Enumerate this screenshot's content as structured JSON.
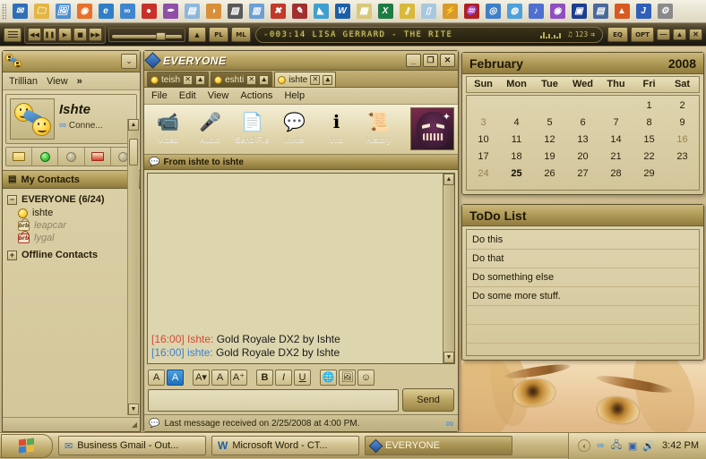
{
  "quicklaunch": {
    "icons": [
      {
        "name": "outlook-icon",
        "glyph": "✉",
        "color": "#2f6fb8"
      },
      {
        "name": "folder-icon",
        "glyph": "🗀",
        "color": "#e3b544"
      },
      {
        "name": "photo-viewer-icon",
        "glyph": "🖼",
        "color": "#4f8fd0"
      },
      {
        "name": "firefox-icon",
        "glyph": "◉",
        "color": "#e8702a"
      },
      {
        "name": "internet-explorer-icon",
        "glyph": "e",
        "color": "#2f7fc8"
      },
      {
        "name": "trillian-icon",
        "glyph": "∞",
        "color": "#3f86cf"
      },
      {
        "name": "red-blob-icon",
        "glyph": "●",
        "color": "#c8312a"
      },
      {
        "name": "pen-icon",
        "glyph": "✒",
        "color": "#8e4fa8"
      },
      {
        "name": "notepad-icon",
        "glyph": "▤",
        "color": "#8fb7dd"
      },
      {
        "name": "paint-palette-icon",
        "glyph": "◑",
        "color": "#d88f3a"
      },
      {
        "name": "cursor-tool-icon",
        "glyph": "▨",
        "color": "#5a5a5a"
      },
      {
        "name": "blue-document-icon",
        "glyph": "▥",
        "color": "#6d9fd4"
      },
      {
        "name": "red-ribbon-icon",
        "glyph": "✖",
        "color": "#c0392b"
      },
      {
        "name": "quill-icon",
        "glyph": "✎",
        "color": "#a03030"
      },
      {
        "name": "sail-icon",
        "glyph": "◣",
        "color": "#3f9fd0"
      },
      {
        "name": "word-icon",
        "glyph": "W",
        "color": "#1b5fa8"
      },
      {
        "name": "excel-chart-icon",
        "glyph": "▦",
        "color": "#d8c87a"
      },
      {
        "name": "excel-icon",
        "glyph": "X",
        "color": "#1e7a43"
      },
      {
        "name": "key-icon",
        "glyph": "⚷",
        "color": "#d8b93a"
      },
      {
        "name": "page-icon",
        "glyph": "▯",
        "color": "#a8c8e0"
      },
      {
        "name": "lightning-icon",
        "glyph": "⚡",
        "color": "#d89a2a"
      },
      {
        "name": "fountain-icon",
        "glyph": "♒",
        "color": "#b02020"
      },
      {
        "name": "cd-player-icon",
        "glyph": "◎",
        "color": "#3f7fc8"
      },
      {
        "name": "media-icon",
        "glyph": "◍",
        "color": "#4fa0d8"
      },
      {
        "name": "music-icon",
        "glyph": "♪",
        "color": "#4f6fd0"
      },
      {
        "name": "purple-disc-icon",
        "glyph": "◉",
        "color": "#8e4fc0"
      },
      {
        "name": "screen-icon",
        "glyph": "▣",
        "color": "#1b3f8f"
      },
      {
        "name": "book-icon",
        "glyph": "▤",
        "color": "#4a6a9a"
      },
      {
        "name": "flame-icon",
        "glyph": "▲",
        "color": "#d85a20"
      },
      {
        "name": "jet-icon",
        "glyph": "J",
        "color": "#2f5fb8"
      },
      {
        "name": "gadget-icon",
        "glyph": "⚙",
        "color": "#8a8a8a"
      }
    ]
  },
  "player": {
    "menu_label": "≡",
    "transport": [
      {
        "name": "previous-button",
        "label": "◀◀"
      },
      {
        "name": "pause-button",
        "label": "❚❚"
      },
      {
        "name": "play-button",
        "label": "▶"
      },
      {
        "name": "stop-button",
        "label": "■"
      },
      {
        "name": "next-button",
        "label": "▶▶"
      }
    ],
    "eject_label": "▲",
    "playlist_label": "PL",
    "medialibrary_label": "ML",
    "track_display": "-003:14  LISA GERRARD  -  THE RITE",
    "bitrate_label": "123",
    "eq_label": "EQ",
    "opt_label": "OPT",
    "window_controls": [
      {
        "name": "player-minimize-button",
        "label": "—"
      },
      {
        "name": "player-shade-button",
        "label": "▲"
      },
      {
        "name": "player-close-button",
        "label": "✕"
      }
    ]
  },
  "trillian": {
    "menu": [
      "Trillian",
      "View",
      "»"
    ],
    "collapse_label": "⌄",
    "profile": {
      "name": "Ishte",
      "status": "Conne..."
    },
    "status_buttons": [
      {
        "name": "status-available-button",
        "kind": "envelope-yellow"
      },
      {
        "name": "status-online-button",
        "kind": "dot-green"
      },
      {
        "name": "status-idle-button",
        "kind": "dot-gray"
      },
      {
        "name": "status-message-button",
        "kind": "envelope-red"
      },
      {
        "name": "status-offline-button",
        "kind": "dot-gray"
      }
    ],
    "contacts_header": "My Contacts",
    "groups": [
      {
        "name": "EVERYONE (6/24)",
        "expander": "−",
        "buddies": [
          {
            "name": "ishte",
            "state": "online",
            "icon": "online-dot"
          },
          {
            "name": "leapcar",
            "state": "away",
            "icon": "brb"
          },
          {
            "name": "lygal",
            "state": "away",
            "icon": "brb-red"
          }
        ]
      },
      {
        "name": "Offline Contacts",
        "expander": "+",
        "buddies": []
      }
    ]
  },
  "chat": {
    "title": "EVERYONE",
    "window_controls": [
      {
        "name": "chat-minimize-button",
        "label": "_"
      },
      {
        "name": "chat-maximize-button",
        "label": "❐"
      },
      {
        "name": "chat-close-button",
        "label": "✕"
      }
    ],
    "tabs": [
      {
        "label": "teish",
        "active": false
      },
      {
        "label": "eshti",
        "active": false
      },
      {
        "label": "ishte",
        "active": true
      }
    ],
    "tab_close_label": "✕",
    "tab_detach_label": "▲",
    "menu": [
      "File",
      "Edit",
      "View",
      "Actions",
      "Help"
    ],
    "toolbar": [
      {
        "name": "video-button",
        "label": "Video",
        "glyph": "📹"
      },
      {
        "name": "audio-button",
        "label": "Audio",
        "glyph": "🎤"
      },
      {
        "name": "send-file-button",
        "label": "Send File",
        "glyph": "📄"
      },
      {
        "name": "invite-button",
        "label": "Invite",
        "glyph": "💬"
      },
      {
        "name": "info-button",
        "label": "Info",
        "glyph": "ℹ"
      },
      {
        "name": "history-button",
        "label": "History",
        "glyph": "📜"
      }
    ],
    "conversation_header": "From ishte to ishte",
    "messages": [
      {
        "time": "[16:00]",
        "sender": "Ishte:",
        "text": "Gold Royale DX2 by Ishte",
        "color": "red"
      },
      {
        "time": "[16:00]",
        "sender": "ishte:",
        "text": "Gold Royale DX2 by Ishte",
        "color": "blue"
      }
    ],
    "format_buttons": [
      {
        "name": "font-color-button",
        "label": "A",
        "selected": false
      },
      {
        "name": "font-background-button",
        "label": "A",
        "selected": true
      },
      {
        "name": "font-family-button",
        "label": "A▾",
        "selected": false
      },
      {
        "name": "font-size-down-button",
        "label": "A",
        "selected": false
      },
      {
        "name": "font-size-up-button",
        "label": "A⁺",
        "selected": false
      },
      {
        "name": "bold-button",
        "label": "B",
        "selected": false
      },
      {
        "name": "italic-button",
        "label": "I",
        "selected": false
      },
      {
        "name": "underline-button",
        "label": "U",
        "selected": false
      },
      {
        "name": "insert-link-button",
        "label": "🌐",
        "selected": false
      },
      {
        "name": "insert-image-button",
        "label": "🖼",
        "selected": false
      },
      {
        "name": "emoticon-button",
        "label": "☺",
        "selected": false
      }
    ],
    "input_value": "",
    "send_label": "Send",
    "status_text": "Last message received on 2/25/2008 at 4:00 PM."
  },
  "calendar": {
    "month": "February",
    "year": "2008",
    "day_headers": [
      "Sun",
      "Mon",
      "Tue",
      "Wed",
      "Thu",
      "Fri",
      "Sat"
    ],
    "cells": [
      {
        "d": "",
        "style": ""
      },
      {
        "d": "",
        "style": ""
      },
      {
        "d": "",
        "style": ""
      },
      {
        "d": "",
        "style": ""
      },
      {
        "d": "",
        "style": ""
      },
      {
        "d": "1",
        "style": ""
      },
      {
        "d": "2",
        "style": ""
      },
      {
        "d": "3",
        "style": "dim"
      },
      {
        "d": "4",
        "style": ""
      },
      {
        "d": "5",
        "style": ""
      },
      {
        "d": "6",
        "style": ""
      },
      {
        "d": "7",
        "style": ""
      },
      {
        "d": "8",
        "style": ""
      },
      {
        "d": "9",
        "style": ""
      },
      {
        "d": "10",
        "style": ""
      },
      {
        "d": "11",
        "style": ""
      },
      {
        "d": "12",
        "style": ""
      },
      {
        "d": "13",
        "style": ""
      },
      {
        "d": "14",
        "style": ""
      },
      {
        "d": "15",
        "style": ""
      },
      {
        "d": "16",
        "style": "dim"
      },
      {
        "d": "17",
        "style": ""
      },
      {
        "d": "18",
        "style": ""
      },
      {
        "d": "19",
        "style": ""
      },
      {
        "d": "20",
        "style": ""
      },
      {
        "d": "21",
        "style": ""
      },
      {
        "d": "22",
        "style": ""
      },
      {
        "d": "23",
        "style": ""
      },
      {
        "d": "24",
        "style": "dim"
      },
      {
        "d": "25",
        "style": "today"
      },
      {
        "d": "26",
        "style": ""
      },
      {
        "d": "27",
        "style": ""
      },
      {
        "d": "28",
        "style": ""
      },
      {
        "d": "29",
        "style": ""
      },
      {
        "d": "",
        "style": ""
      }
    ]
  },
  "todo": {
    "title": "ToDo List",
    "items": [
      "Do this",
      "Do that",
      "Do something else",
      "Do some more stuff.",
      "",
      ""
    ]
  },
  "taskbar": {
    "start_label": "",
    "tasks": [
      {
        "label": "Business Gmail - Out...",
        "icon": "outlook-icon",
        "active": false
      },
      {
        "label": "Microsoft Word - CT...",
        "icon": "word-icon",
        "active": false
      },
      {
        "label": "EVERYONE",
        "icon": "trillian-diamond-icon",
        "active": true
      }
    ],
    "tray_icons": [
      {
        "name": "tray-expand-icon",
        "glyph": "‹"
      },
      {
        "name": "tray-trillian-icon",
        "glyph": "∞"
      },
      {
        "name": "tray-network-icon",
        "glyph": "🖧"
      },
      {
        "name": "tray-app-icon",
        "glyph": "▣"
      },
      {
        "name": "tray-volume-icon",
        "glyph": "🔊"
      }
    ],
    "clock": "3:42 PM"
  }
}
